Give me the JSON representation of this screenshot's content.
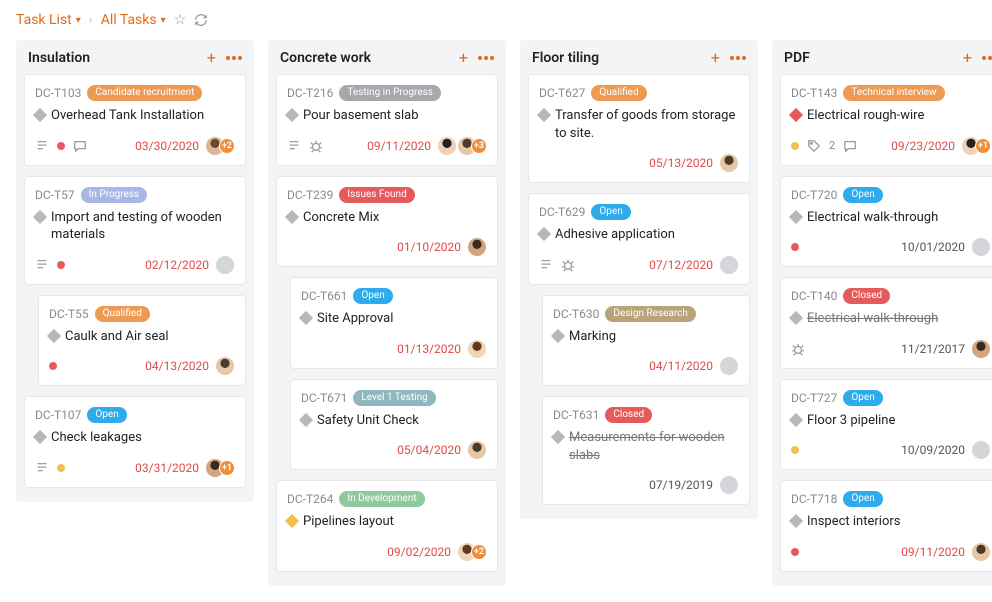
{
  "breadcrumb": {
    "root": "Task List",
    "current": "All Tasks"
  },
  "status_colors": {
    "Candidate recruitment": "#ed9a53",
    "In Progress": "#a9b7e8",
    "Qualified": "#ed9a53",
    "Open": "#2dabea",
    "Testing in Progress": "#a7a7ae",
    "Issues Found": "#e55b5b",
    "Level 1 Testing": "#8fb7bf",
    "In Development": "#8fc99d",
    "Design Research": "#b7a478",
    "Closed": "#e55b5b",
    "Technical interview": "#ed9a53"
  },
  "columns": [
    {
      "title": "Insulation",
      "cards": [
        {
          "id": "DC-T103",
          "status": "Candidate recruitment",
          "title": "Overhead Tank Installation",
          "diamond": "gray",
          "date": "03/30/2020",
          "date_overdue": true,
          "icons": [
            "subtasks",
            "red-dot",
            "comments"
          ],
          "avatars": [
            "p1"
          ],
          "extra_count": "+2"
        },
        {
          "id": "DC-T57",
          "status": "In Progress",
          "title": "Import and testing of wooden materials",
          "diamond": "gray",
          "date": "02/12/2020",
          "date_overdue": true,
          "icons": [
            "subtasks",
            "red-dot"
          ],
          "avatars": [
            "empty"
          ]
        },
        {
          "id": "DC-T55",
          "status": "Qualified",
          "title": "Caulk and Air seal",
          "diamond": "gray",
          "date": "04/13/2020",
          "date_overdue": true,
          "icons": [
            "red-dot"
          ],
          "avatars": [
            "p2"
          ],
          "nested": true
        },
        {
          "id": "DC-T107",
          "status": "Open",
          "title": "Check leakages",
          "diamond": "gray",
          "date": "03/31/2020",
          "date_overdue": true,
          "icons": [
            "subtasks",
            "yellow-dot"
          ],
          "avatars": [
            "p3"
          ],
          "extra_count": "+1"
        }
      ]
    },
    {
      "title": "Concrete work",
      "cards": [
        {
          "id": "DC-T216",
          "status": "Testing in Progress",
          "title": "Pour basement slab",
          "diamond": "gray",
          "date": "09/11/2020",
          "date_overdue": true,
          "icons": [
            "subtasks",
            "bug"
          ],
          "avatars": [
            "p4",
            "p2"
          ],
          "extra_count": "+3"
        },
        {
          "id": "DC-T239",
          "status": "Issues Found",
          "title": "Concrete Mix",
          "diamond": "gray",
          "date": "01/10/2020",
          "date_overdue": true,
          "icons": [],
          "avatars": [
            "p3"
          ]
        },
        {
          "id": "DC-T661",
          "status": "Open",
          "title": "Site Approval",
          "diamond": "gray",
          "date": "01/13/2020",
          "date_overdue": true,
          "icons": [],
          "avatars": [
            "p5"
          ],
          "nested": true
        },
        {
          "id": "DC-T671",
          "status": "Level 1 Testing",
          "title": "Safety Unit Check",
          "diamond": "gray",
          "date": "05/04/2020",
          "date_overdue": true,
          "icons": [],
          "avatars": [
            "p2"
          ],
          "nested": true
        },
        {
          "id": "DC-T264",
          "status": "In Development",
          "title": "Pipelines layout",
          "diamond": "yellow",
          "date": "09/02/2020",
          "date_overdue": true,
          "icons": [],
          "avatars": [
            "p5"
          ],
          "extra_count": "+2"
        }
      ]
    },
    {
      "title": "Floor tiling",
      "cards": [
        {
          "id": "DC-T627",
          "status": "Qualified",
          "title": "Transfer of goods from storage to site.",
          "diamond": "gray",
          "date": "05/13/2020",
          "date_overdue": true,
          "icons": [],
          "avatars": [
            "p2"
          ]
        },
        {
          "id": "DC-T629",
          "status": "Open",
          "title": "Adhesive application",
          "diamond": "gray",
          "date": "07/12/2020",
          "date_overdue": true,
          "icons": [
            "subtasks",
            "bug"
          ],
          "avatars": [
            "empty"
          ]
        },
        {
          "id": "DC-T630",
          "status": "Design Research",
          "title": "Marking",
          "diamond": "gray",
          "date": "04/11/2020",
          "date_overdue": true,
          "icons": [],
          "avatars": [
            "empty"
          ],
          "nested": true
        },
        {
          "id": "DC-T631",
          "status": "Closed",
          "title": "Measurements for wooden slabs",
          "diamond": "gray",
          "strike": true,
          "date": "07/19/2019",
          "date_overdue": false,
          "icons": [],
          "avatars": [
            "empty"
          ],
          "nested": true
        }
      ]
    },
    {
      "title": "PDF",
      "cards": [
        {
          "id": "DC-T143",
          "status": "Technical interview",
          "title": "Electrical rough-wire",
          "diamond": "red",
          "date": "09/23/2020",
          "date_overdue": true,
          "icons": [
            "yellow-dot",
            "tag",
            "tagcount:2",
            "comments"
          ],
          "avatars": [
            "p4"
          ],
          "extra_count": "+1"
        },
        {
          "id": "DC-T720",
          "status": "Open",
          "title": "Electrical walk-through",
          "diamond": "gray",
          "date": "10/01/2020",
          "date_overdue": false,
          "icons": [
            "red-dot"
          ],
          "avatars": [
            "empty"
          ]
        },
        {
          "id": "DC-T140",
          "status": "Closed",
          "title": "Electrical walk-through",
          "diamond": "gray",
          "strike": true,
          "date": "11/21/2017",
          "date_overdue": false,
          "icons": [
            "bug"
          ],
          "avatars": [
            "p3"
          ]
        },
        {
          "id": "DC-T727",
          "status": "Open",
          "title": "Floor 3 pipeline",
          "diamond": "gray",
          "date": "10/09/2020",
          "date_overdue": false,
          "icons": [
            "yellow-dot"
          ],
          "avatars": [
            "empty"
          ]
        },
        {
          "id": "DC-T718",
          "status": "Open",
          "title": "Inspect interiors",
          "diamond": "gray",
          "date": "09/11/2020",
          "date_overdue": true,
          "icons": [
            "red-dot"
          ],
          "avatars": [
            "p2"
          ]
        }
      ]
    }
  ]
}
